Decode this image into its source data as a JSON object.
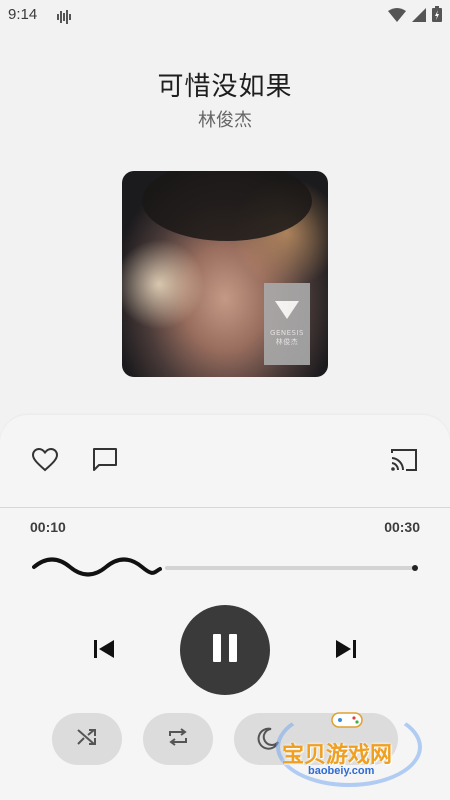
{
  "status_bar": {
    "time": "9:14",
    "signal_icon": "sound-wave-icon",
    "right_icons": [
      "wifi-icon",
      "cellular-icon",
      "battery-icon"
    ]
  },
  "song": {
    "title": "可惜没如果",
    "artist": "林俊杰"
  },
  "album": {
    "label_text": "GENESIS",
    "label_sub": "林俊杰"
  },
  "actions": {
    "left": [
      "heart-icon",
      "comment-icon"
    ],
    "right": [
      "cast-icon"
    ]
  },
  "progress": {
    "current_time": "00:10",
    "total_time": "00:30",
    "played_fraction": 0.33
  },
  "controls": {
    "previous": "skip-previous-icon",
    "play_pause": "pause-icon",
    "next": "skip-next-icon"
  },
  "bottom_toggles": [
    "shuffle-icon",
    "repeat-icon",
    "sleep-timer-icon"
  ],
  "watermark": {
    "text": "宝贝游戏网",
    "url": "baobeiy.com"
  },
  "colors": {
    "background": "#f2f2f2",
    "panel": "#f5f5f5",
    "play_button": "#3a3a3a",
    "pill": "#dcdcdc"
  }
}
